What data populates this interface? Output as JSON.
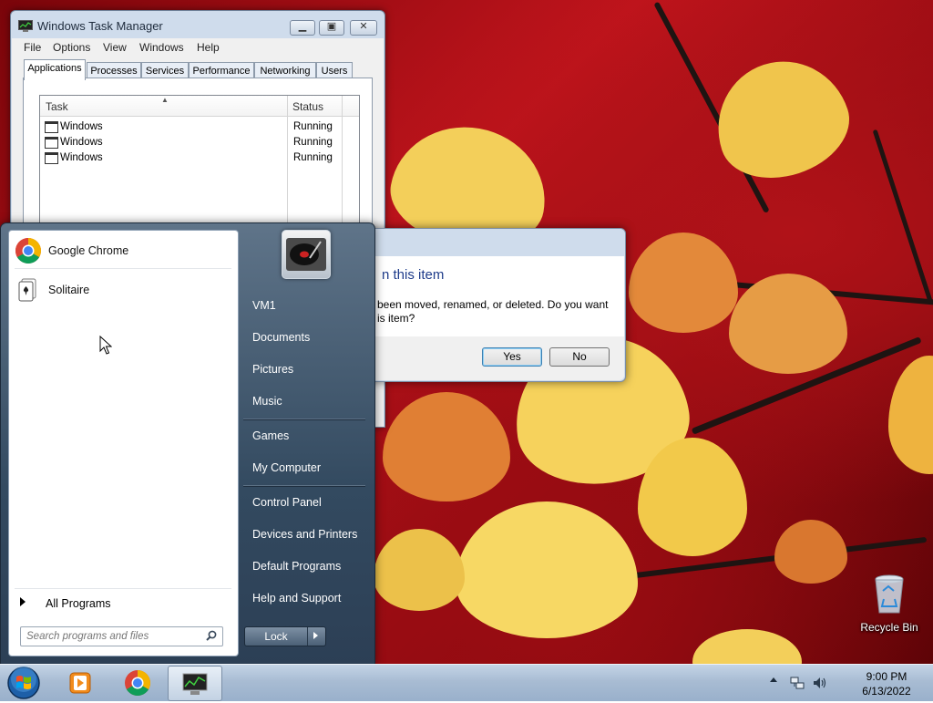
{
  "desktop": {
    "recycle_bin_label": "Recycle Bin"
  },
  "task_manager": {
    "title": "Windows Task Manager",
    "menu": [
      "File",
      "Options",
      "View",
      "Windows",
      "Help"
    ],
    "tabs": [
      "Applications",
      "Processes",
      "Services",
      "Performance",
      "Networking",
      "Users"
    ],
    "active_tab": "Applications",
    "columns": [
      "Task",
      "Status"
    ],
    "rows": [
      {
        "task": "Windows",
        "status": "Running"
      },
      {
        "task": "Windows",
        "status": "Running"
      },
      {
        "task": "Windows",
        "status": "Running"
      }
    ]
  },
  "dialog": {
    "heading": "n this item",
    "message_line1": "been moved, renamed, or deleted. Do you want",
    "message_line2": "is item?",
    "yes_label": "Yes",
    "no_label": "No"
  },
  "start_menu": {
    "pinned": [
      {
        "label": "Google Chrome",
        "icon": "chrome-icon"
      },
      {
        "label": "Solitaire",
        "icon": "solitaire-icon"
      }
    ],
    "all_programs_label": "All Programs",
    "search_placeholder": "Search programs and files",
    "right_links": [
      "VM1",
      "Documents",
      "Pictures",
      "Music",
      "Games",
      "My Computer",
      "Control Panel",
      "Devices and Printers",
      "Default Programs",
      "Help and Support"
    ],
    "lock_label": "Lock"
  },
  "taskbar": {
    "time": "9:00 PM",
    "date": "6/13/2022",
    "pinned_apps": [
      "media-player-icon",
      "chrome-icon",
      "task-manager-icon"
    ]
  },
  "colors": {
    "wallpaper_red": "#c0141c",
    "leaf_yellow": "#f2c94a",
    "start_menu_blue": "#334a60",
    "dialog_heading_blue": "#1e3b8a"
  }
}
